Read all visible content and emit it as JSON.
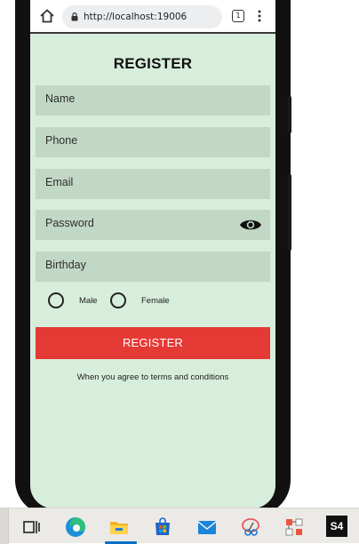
{
  "browser": {
    "url": "http://localhost:19006",
    "tab_count": "1"
  },
  "form": {
    "title": "REGISTER",
    "fields": {
      "name": "Name",
      "phone": "Phone",
      "email": "Email",
      "password": "Password",
      "birthday": "Birthday"
    },
    "gender": {
      "male": "Male",
      "female": "Female"
    },
    "submit_label": "REGISTER",
    "terms_text": "When you agree to terms and conditions"
  },
  "taskbar": {
    "s4_label": "S4"
  },
  "colors": {
    "screen_bg": "#d8eedc",
    "field_bg": "#c2d8c6",
    "button_bg": "#e53935"
  }
}
